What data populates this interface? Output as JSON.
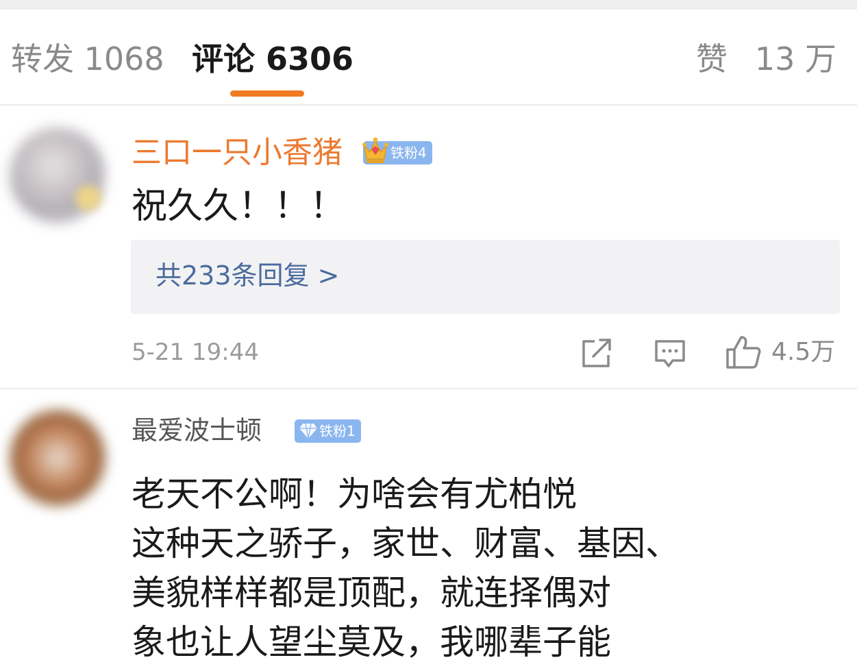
{
  "tabs": {
    "repost": "转发 1068",
    "comment": "评论 6306",
    "like_label": "赞",
    "like_count": "13 万",
    "active": "comment",
    "indicator_color": "#f07b22"
  },
  "comments": [
    {
      "username": "三口一只小香猪",
      "badge": "铁粉4",
      "text": "祝久久！！！",
      "replies_link": "共233条回复 >",
      "time": "5-21 19:44",
      "likes": "4.5万",
      "username_color": "#eb7a30"
    },
    {
      "username": "最爱波士顿",
      "badge": "铁粉1",
      "text_lines": [
        "老天不公啊！为啥会有尤柏悦",
        "这种天之骄子，家世、财富、基因、",
        "美貌样样都是顶配，就连择偶对",
        "象也让人望尘莫及，我哪辈子能"
      ]
    }
  ],
  "icons": {
    "share": "share-icon",
    "comment": "comment-icon",
    "like": "thumbs-up-icon",
    "crown": "crown-icon",
    "diamond": "diamond-icon"
  }
}
